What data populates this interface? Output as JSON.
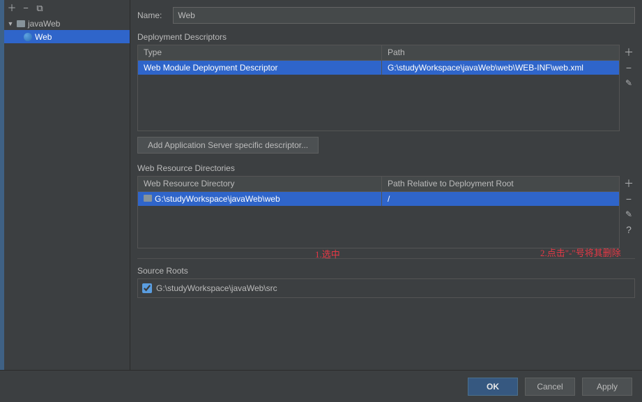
{
  "tree": {
    "root": "javaWeb",
    "child": "Web"
  },
  "form": {
    "name_label": "Name:",
    "name_value": "Web"
  },
  "sections": {
    "descriptors_title": "Deployment Descriptors",
    "descriptors": {
      "col1": "Type",
      "col2": "Path",
      "row_type": "Web Module Deployment Descriptor",
      "row_path": "G:\\studyWorkspace\\javaWeb\\web\\WEB-INF\\web.xml",
      "add_button": "Add Application Server specific descriptor..."
    },
    "resources_title": "Web Resource Directories",
    "resources": {
      "col1": "Web Resource Directory",
      "col2": "Path Relative to Deployment Root",
      "row_dir": "G:\\studyWorkspace\\javaWeb\\web",
      "row_path": "/"
    },
    "source_title": "Source Roots",
    "source_path": "G:\\studyWorkspace\\javaWeb\\src"
  },
  "annotations": {
    "select": "1.选中",
    "delete": "2.点击\"-\"号将其删除"
  },
  "footer": {
    "ok": "OK",
    "cancel": "Cancel",
    "apply": "Apply"
  }
}
